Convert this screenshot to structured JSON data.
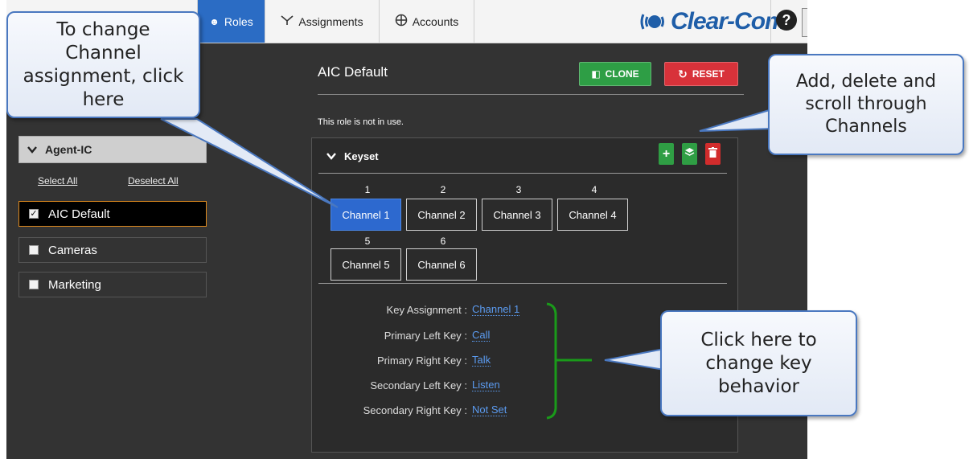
{
  "nav": {
    "tabs": [
      {
        "label": "Roles",
        "active": true
      },
      {
        "label": "Assignments"
      },
      {
        "label": "Accounts"
      }
    ],
    "brand": "Clear-Com",
    "help_icon": "question-circle-icon"
  },
  "sidebar": {
    "group_label": "Agent-IC",
    "select_all": "Select All",
    "deselect_all": "Deselect All",
    "roles": [
      {
        "label": "AIC Default",
        "checked": true
      },
      {
        "label": "Cameras",
        "checked": false
      },
      {
        "label": "Marketing",
        "checked": false
      }
    ]
  },
  "main": {
    "role_title": "AIC Default",
    "clone_label": "CLONE",
    "reset_label": "RESET",
    "status_text": "This role is not in use.",
    "keyset": {
      "title": "Keyset",
      "channels": [
        {
          "num": "1",
          "label": "Channel 1",
          "active": true
        },
        {
          "num": "2",
          "label": "Channel 2"
        },
        {
          "num": "3",
          "label": "Channel 3"
        },
        {
          "num": "4",
          "label": "Channel 4"
        },
        {
          "num": "5",
          "label": "Channel 5"
        },
        {
          "num": "6",
          "label": "Channel 6"
        }
      ],
      "properties": [
        {
          "label": "Key Assignment :",
          "value": "Channel 1"
        },
        {
          "label": "Primary Left Key :",
          "value": "Call"
        },
        {
          "label": "Primary Right Key :",
          "value": "Talk"
        },
        {
          "label": "Secondary Left Key :",
          "value": "Listen"
        },
        {
          "label": "Secondary Right Key :",
          "value": "Not Set"
        }
      ]
    }
  },
  "callouts": {
    "channel_assign": "To change Channel assignment, click here",
    "add_delete": "Add, delete and scroll through Channels",
    "key_behavior": "Click here to change key behavior"
  },
  "colors": {
    "accent_blue": "#2b6cc4",
    "clone_green": "#2e9e45",
    "reset_red": "#d8323a",
    "bracket_green": "#1a9a1a",
    "selected_border": "#e08a1e"
  }
}
